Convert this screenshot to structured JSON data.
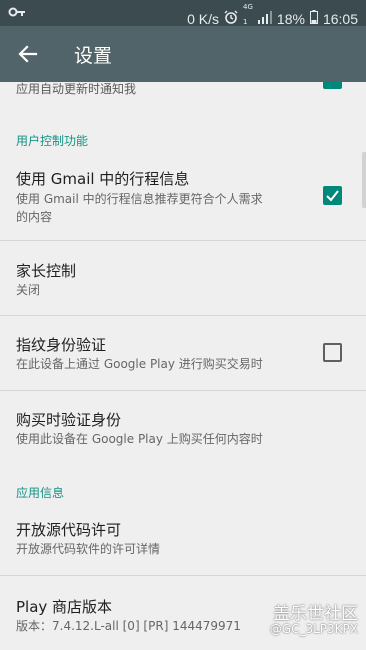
{
  "status": {
    "speed": "0 K/s",
    "net_small_top": "4G",
    "net_small_bottom": "1",
    "battery": "18%",
    "time": "16:05"
  },
  "appbar": {
    "title": "设置"
  },
  "partial_row": {
    "subtitle": "应用自动更新时通知我",
    "checked": true
  },
  "sections": {
    "user_controls": "用户控制功能",
    "app_info": "应用信息"
  },
  "items": [
    {
      "title": "使用 Gmail 中的行程信息",
      "subtitle_line1": "使用 Gmail 中的行程信息推荐更符合个人需求",
      "subtitle_line2": "的内容",
      "checked": true
    },
    {
      "title": "家长控制",
      "subtitle": "关闭"
    },
    {
      "title": "指纹身份验证",
      "subtitle": "在此设备上通过 Google Play 进行购买交易时",
      "checked": false
    },
    {
      "title": "购买时验证身份",
      "subtitle": "使用此设备在 Google Play 上购买任何内容时"
    },
    {
      "title": "开放源代码许可",
      "subtitle": "开放源代码软件的许可详情"
    },
    {
      "title": "Play 商店版本",
      "subtitle": "版本：7.4.12.L-all [0] [PR] 144479971"
    }
  ],
  "watermark": {
    "brand": "盖乐世社区",
    "user": "@GC_3LP3KPX"
  },
  "colors": {
    "accent": "#00897b",
    "appbar": "#516469",
    "statusbar": "#3c4b4f"
  }
}
